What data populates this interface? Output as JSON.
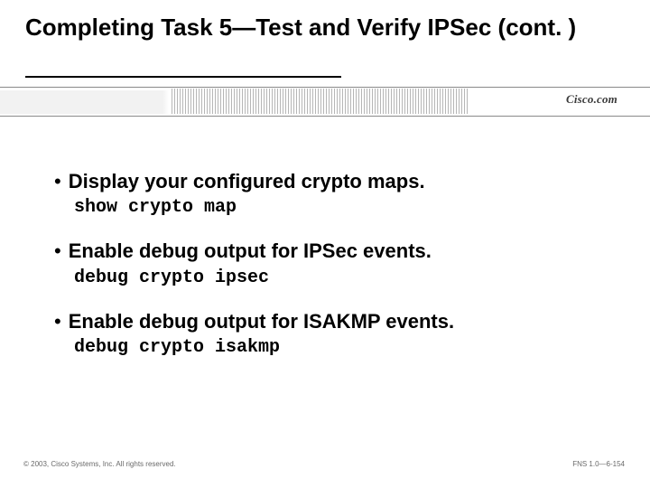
{
  "title": "Completing Task 5—Test and Verify IPSec (cont. )",
  "logo": "Cisco.com",
  "bullets": [
    {
      "text": "Display your configured crypto maps.",
      "cmd": "show crypto map"
    },
    {
      "text": "Enable debug output for IPSec events.",
      "cmd": "debug crypto ipsec"
    },
    {
      "text": "Enable debug output for ISAKMP events.",
      "cmd": "debug crypto isakmp"
    }
  ],
  "footer": {
    "left": "© 2003, Cisco Systems, Inc. All rights reserved.",
    "right": "FNS 1.0—6-154"
  }
}
